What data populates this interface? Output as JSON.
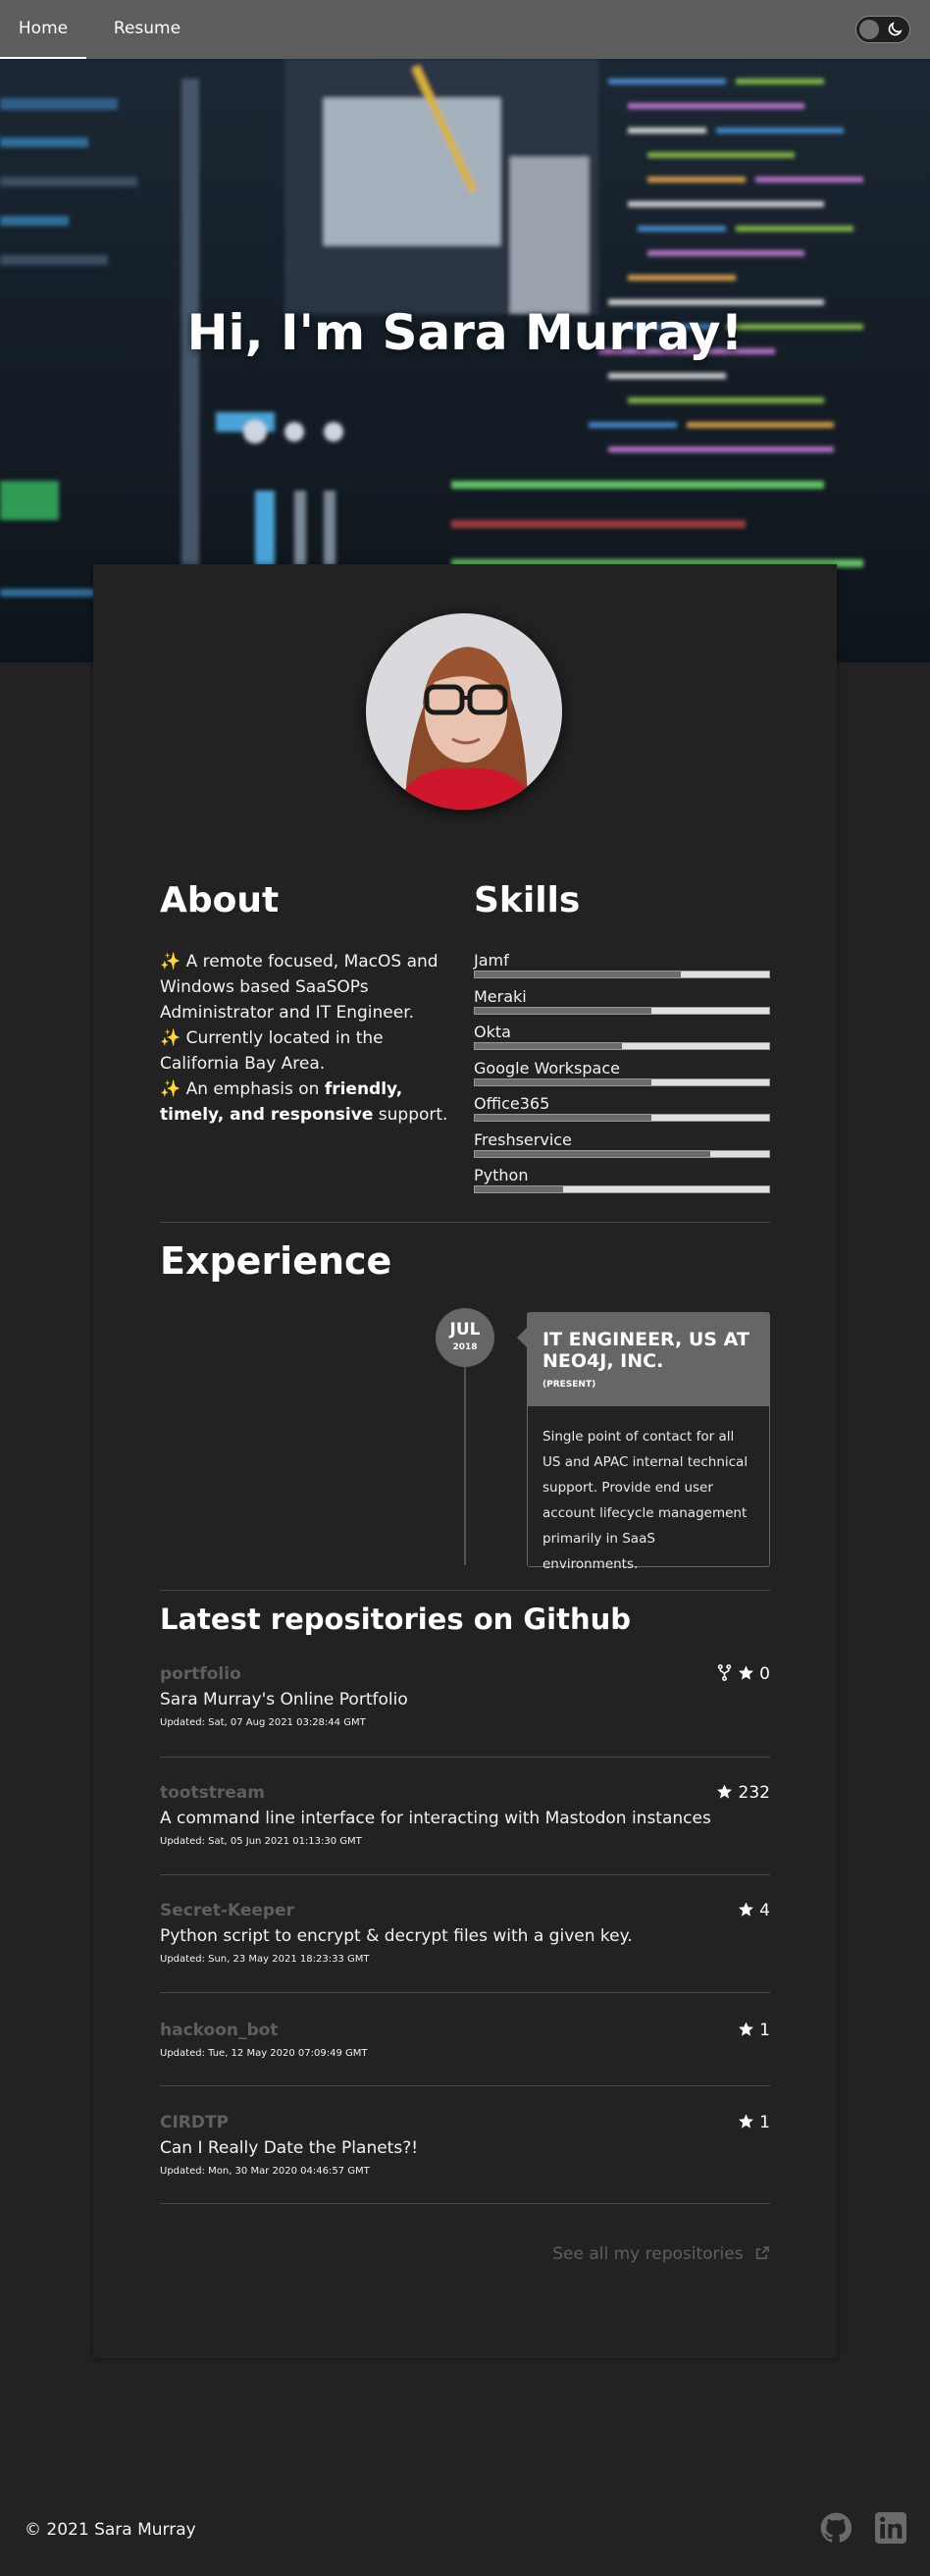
{
  "nav": {
    "home": "Home",
    "resume": "Resume"
  },
  "hero": {
    "title": "Hi, I'm Sara Murray!"
  },
  "about": {
    "title": "About",
    "line1": "A remote focused, MacOS and Windows based SaaSOPs Administrator and IT Engineer.",
    "line2": "Currently located in the California Bay Area.",
    "line3_pre": "An emphasis on ",
    "line3_bold": "friendly, timely, and responsive",
    "line3_post": " support."
  },
  "skills": {
    "title": "Skills",
    "items": [
      {
        "name": "Jamf",
        "level": 0.7
      },
      {
        "name": "Meraki",
        "level": 0.6
      },
      {
        "name": "Okta",
        "level": 0.5
      },
      {
        "name": "Google Workspace",
        "level": 0.6
      },
      {
        "name": "Office365",
        "level": 0.6
      },
      {
        "name": "Freshservice",
        "level": 0.8
      },
      {
        "name": "Python",
        "level": 0.3
      }
    ]
  },
  "experience": {
    "title": "Experience",
    "month": "JUL",
    "year": "2018",
    "role": "IT ENGINEER, US AT NEO4J, INC.",
    "status": "(PRESENT)",
    "description": "Single point of contact for all US and APAC internal technical support. Provide end user account lifecycle management primarily in SaaS environments."
  },
  "repos": {
    "title": "Latest repositories on Github",
    "items": [
      {
        "name": "portfolio",
        "description": "Sara Murray's Online Portfolio",
        "updated": "Updated: Sat, 07 Aug 2021 03:28:44 GMT",
        "stars": "0",
        "fork": true
      },
      {
        "name": "tootstream",
        "description": "A command line interface for interacting with Mastodon instances",
        "updated": "Updated: Sat, 05 Jun 2021 01:13:30 GMT",
        "stars": "232",
        "fork": false
      },
      {
        "name": "Secret-Keeper",
        "description": "Python script to encrypt & decrypt files with a given key.",
        "updated": "Updated: Sun, 23 May 2021 18:23:33 GMT",
        "stars": "4",
        "fork": false
      },
      {
        "name": "hackoon_bot",
        "description": "",
        "updated": "Updated: Tue, 12 May 2020 07:09:49 GMT",
        "stars": "1",
        "fork": false
      },
      {
        "name": "CIRDTP",
        "description": "Can I Really Date the Planets?!",
        "updated": "Updated: Mon, 30 Mar 2020 04:46:57 GMT",
        "stars": "1",
        "fork": false
      }
    ],
    "see_all": "See all my repositories"
  },
  "footer": {
    "copyright": "© 2021 Sara Murray"
  },
  "icons": {
    "theme": "moon-icon",
    "fork": "fork-icon",
    "star": "star-icon",
    "external": "external-link-icon",
    "github": "github-icon",
    "linkedin": "linkedin-icon"
  }
}
